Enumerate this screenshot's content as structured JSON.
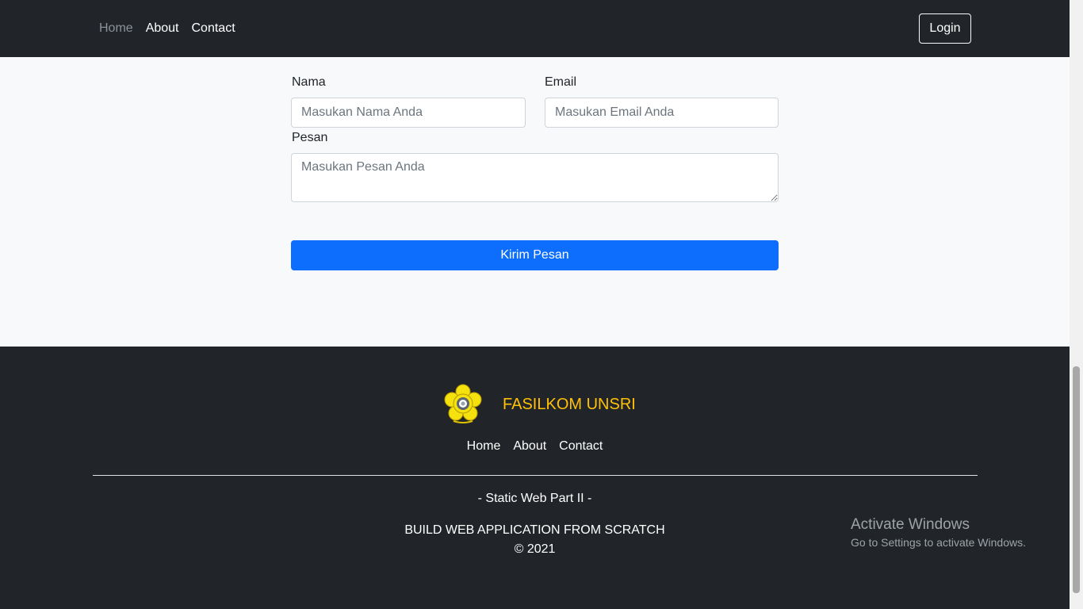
{
  "nav": {
    "links": [
      "Home",
      "About",
      "Contact"
    ],
    "login_label": "Login"
  },
  "form": {
    "name_label": "Nama",
    "name_placeholder": "Masukan Nama Anda",
    "email_label": "Email",
    "email_placeholder": "Masukan Email Anda",
    "message_label": "Pesan",
    "message_placeholder": "Masukan Pesan Anda",
    "submit_label": "Kirim Pesan"
  },
  "footer": {
    "brand": "FASILKOM UNSRI",
    "links": [
      "Home",
      "About",
      "Contact"
    ],
    "subtitle": "- Static Web Part II -",
    "build_text": "BUILD WEB APPLICATION FROM SCRATCH",
    "copyright": "© 2021"
  },
  "watermark": {
    "title": "Activate Windows",
    "subtitle": "Go to Settings to activate Windows."
  },
  "colors": {
    "dark": "#212529",
    "light_bg": "#f8f9fa",
    "primary": "#0d6efd",
    "brand_yellow": "#ffc107"
  },
  "icons": {
    "logo": "university-emblem-icon"
  }
}
